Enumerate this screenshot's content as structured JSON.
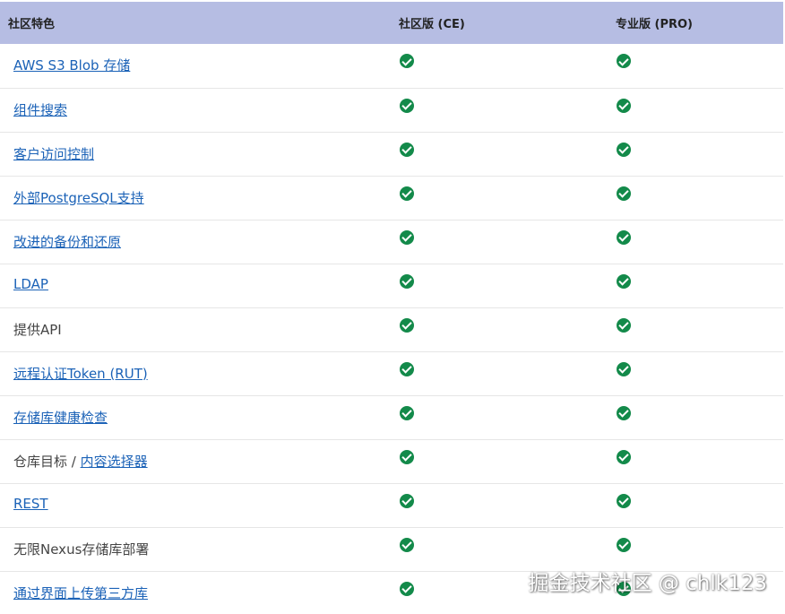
{
  "header": {
    "feature_col": "社区特色",
    "ce_col": "社区版 (CE)",
    "pro_col": "专业版 (PRO)"
  },
  "rows": [
    {
      "feature": "AWS S3 Blob 存储",
      "linked": true
    },
    {
      "feature": "组件搜索",
      "linked": true
    },
    {
      "feature": "客户访问控制",
      "linked": true
    },
    {
      "feature": "外部PostgreSQL支持",
      "linked": true
    },
    {
      "feature": "改进的备份和还原",
      "linked": true
    },
    {
      "feature": "LDAP",
      "linked": true
    },
    {
      "feature": "提供API",
      "linked": false
    },
    {
      "feature": "远程认证Token (RUT)",
      "linked": true
    },
    {
      "feature": "存储库健康检查",
      "linked": true
    },
    {
      "feature_prefix": "仓库目标 / ",
      "feature_link": "内容选择器",
      "linked": "partial"
    },
    {
      "feature": "REST",
      "linked": true
    },
    {
      "feature": "无限Nexus存储库部署",
      "linked": false
    },
    {
      "feature": "通过界面上传第三方库",
      "linked": true
    }
  ],
  "check_icon": "check-circle-icon",
  "colors": {
    "header_bg": "#b6bde3",
    "link": "#1b62b7",
    "check": "#138a4a"
  },
  "watermark": "掘金技术社区 @ chlk123"
}
